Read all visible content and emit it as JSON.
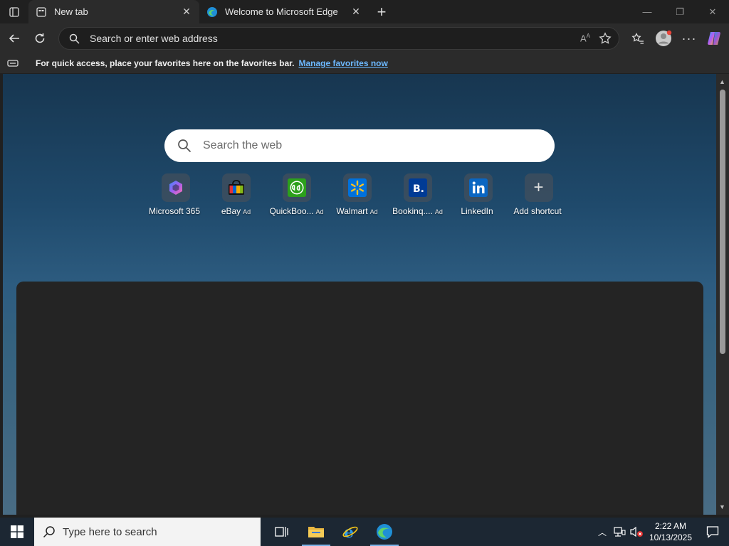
{
  "tabs": [
    {
      "title": "New tab",
      "active": true
    },
    {
      "title": "Welcome to Microsoft Edge",
      "active": false
    }
  ],
  "address_bar": {
    "placeholder": "Search or enter web address"
  },
  "favorites_bar": {
    "message": "For quick access, place your favorites here on the favorites bar.",
    "link": "Manage favorites now"
  },
  "search": {
    "placeholder": "Search the web"
  },
  "shortcuts": [
    {
      "label": "Microsoft 365",
      "ad": ""
    },
    {
      "label": "eBay",
      "ad": "Ad"
    },
    {
      "label": "QuickBoo...",
      "ad": "Ad"
    },
    {
      "label": "Walmart",
      "ad": "Ad"
    },
    {
      "label": "Bookinq....",
      "ad": "Ad"
    },
    {
      "label": "LinkedIn",
      "ad": ""
    },
    {
      "label": "Add shortcut",
      "ad": ""
    }
  ],
  "taskbar": {
    "search_placeholder": "Type here to search",
    "time": "2:22 AM",
    "date": "10/13/2025"
  },
  "colors": {
    "accent_link": "#6cb8ff",
    "taskbar": "#1c2733"
  }
}
